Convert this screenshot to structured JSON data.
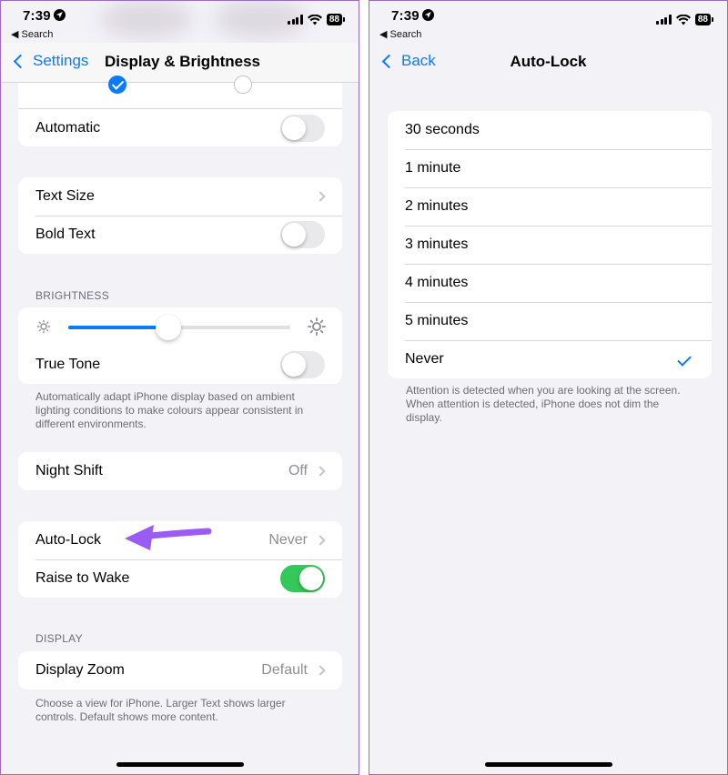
{
  "left": {
    "status": {
      "time": "7:39",
      "back_app": "◀ Search",
      "battery": "88"
    },
    "nav": {
      "back_label": "Settings",
      "title": "Display & Brightness"
    },
    "appearance": {
      "automatic_label": "Automatic",
      "automatic_on": false
    },
    "text": {
      "text_size_label": "Text Size",
      "bold_text_label": "Bold Text",
      "bold_text_on": false
    },
    "brightness": {
      "header": "BRIGHTNESS",
      "level": 0.45,
      "true_tone_label": "True Tone",
      "true_tone_on": false,
      "footer": "Automatically adapt iPhone display based on ambient lighting conditions to make colours appear consistent in different environments."
    },
    "night_shift": {
      "label": "Night Shift",
      "value": "Off"
    },
    "lock": {
      "auto_lock_label": "Auto-Lock",
      "auto_lock_value": "Never",
      "raise_to_wake_label": "Raise to Wake",
      "raise_to_wake_on": true
    },
    "display": {
      "header": "DISPLAY",
      "zoom_label": "Display Zoom",
      "zoom_value": "Default",
      "footer": "Choose a view for iPhone. Larger Text shows larger controls. Default shows more content."
    },
    "annotation_color": "#9b5cf6"
  },
  "right": {
    "status": {
      "time": "7:39",
      "back_app": "◀ Search",
      "battery": "88"
    },
    "nav": {
      "back_label": "Back",
      "title": "Auto-Lock"
    },
    "options": [
      "30 seconds",
      "1 minute",
      "2 minutes",
      "3 minutes",
      "4 minutes",
      "5 minutes",
      "Never"
    ],
    "selected": "Never",
    "footer": "Attention is detected when you are looking at the screen. When attention is detected, iPhone does not dim the display."
  },
  "colors": {
    "accent": "#0a7aff",
    "toggle_on": "#34c759",
    "background": "#f2f2f7"
  }
}
